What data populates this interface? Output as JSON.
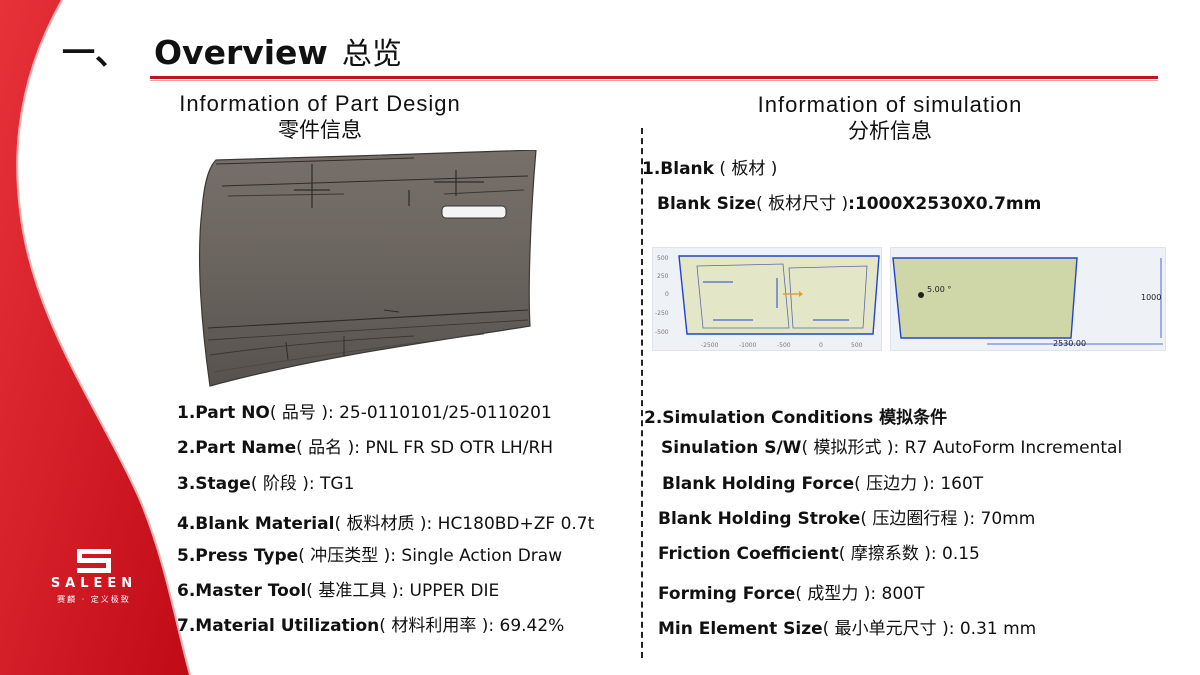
{
  "header": {
    "number": "一、",
    "title_en": "Overview",
    "title_cn": "总览"
  },
  "brand": {
    "name": "SALEEN",
    "tagline": "赛麟 · 定义极致",
    "accent_color": "#d0101c"
  },
  "left": {
    "heading_en": "Information of Part Design",
    "heading_cn": "零件信息",
    "items": [
      {
        "label": "1.Part NO",
        "zh": "( 品号 ): ",
        "value": "25-0110101/25-0110201"
      },
      {
        "label": "2.Part Name",
        "zh": "( 品名 ): ",
        "value": "PNL FR SD OTR LH/RH"
      },
      {
        "label": "3.Stage",
        "zh": "( 阶段 ): ",
        "value": "TG1"
      },
      {
        "label": "4.Blank Material",
        "zh": "( 板料材质 ): ",
        "value": "HC180BD+ZF  0.7t"
      },
      {
        "label": "5.Press Type",
        "zh": "( 冲压类型 ): ",
        "value": "Single Action Draw"
      },
      {
        "label": "6.Master Tool",
        "zh": "( 基准工具 ): ",
        "value": "UPPER DIE"
      },
      {
        "label": "7.Material Utilization",
        "zh": "( 材料利用率 ): ",
        "value": "69.42%"
      }
    ]
  },
  "right": {
    "heading_en": "Information of simulation",
    "heading_cn": "分析信息",
    "blank_title": "1.Blank",
    "blank_title_zh": " ( 板材 )",
    "blank_size_label": "Blank Size",
    "blank_size_zh": "( 板材尺寸 )",
    "blank_size_value": ":1000X2530X0.7mm",
    "cond_title": "2.Simulation Conditions 模拟条件",
    "items": [
      {
        "label": "Sinulation S/W",
        "zh": "( 模拟形式 ): ",
        "value": "R7 AutoForm Incremental"
      },
      {
        "label": "Blank Holding Force",
        "zh": "( 压边力 ): ",
        "value": "160T"
      },
      {
        "label": "Blank Holding Stroke",
        "zh": "( 压边圈行程 ): ",
        "value": "70mm"
      },
      {
        "label": "Friction Coefficient",
        "zh": "( 摩擦系数 ): ",
        "value": "0.15"
      },
      {
        "label": "Forming Force",
        "zh": "( 成型力 ): ",
        "value": "800T"
      },
      {
        "label": "Min Element Size",
        "zh": "( 最小单元尺寸  ): ",
        "value": "0.31 mm"
      }
    ]
  },
  "blank_layout": {
    "y_ticks": [
      "500",
      "250",
      "0",
      "-250",
      "-500"
    ],
    "x_ticks": [
      "-2500",
      "-1000",
      "-500",
      "0",
      "500"
    ]
  },
  "blank_dims": {
    "angle": "5.00 °",
    "height": "1000",
    "width": "2530.00"
  }
}
